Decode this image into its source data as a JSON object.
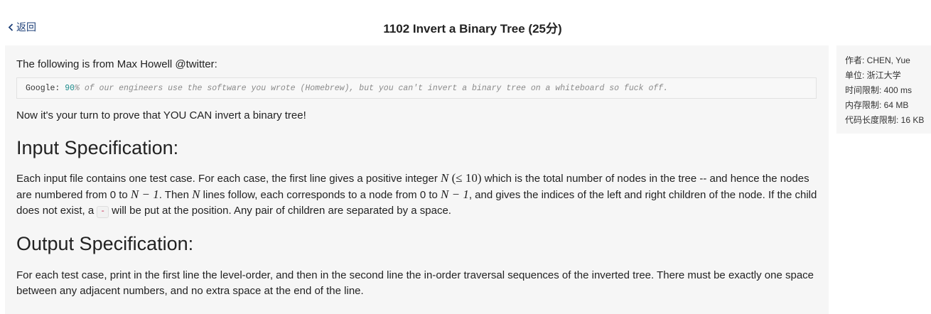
{
  "header": {
    "back_label": "返回",
    "title": "1102 Invert a Binary Tree (25分)"
  },
  "problem": {
    "intro": "The following is from Max Howell @twitter:",
    "quote": {
      "prefix": "Google: ",
      "number": "90",
      "rest": "% of our engineers use the software you wrote (Homebrew), but you can't invert a binary tree on a whiteboard so fuck off."
    },
    "challenge": "Now it's your turn to prove that YOU CAN invert a binary tree!",
    "input_heading": "Input Specification:",
    "input": {
      "t1": "Each input file contains one test case. For each case, the first line gives a positive integer ",
      "m1": "N",
      "m2": "(≤ 10)",
      "t2": " which is the total number of nodes in the tree -- and hence the nodes are numbered from 0 to ",
      "m3": "N − 1",
      "t3": ". Then ",
      "m4": "N",
      "t4": " lines follow, each corresponds to a node from 0 to ",
      "m5": "N − 1",
      "t5": ", and gives the indices of the left and right children of the node. If the child does not exist, a ",
      "code": "-",
      "t6": " will be put at the position. Any pair of children are separated by a space."
    },
    "output_heading": "Output Specification:",
    "output_text": "For each test case, print in the first line the level-order, and then in the second line the in-order traversal sequences of the inverted tree. There must be exactly one space between any adjacent numbers, and no extra space at the end of the line."
  },
  "sidebar": {
    "author": "作者: CHEN, Yue",
    "unit": "单位: 浙江大学",
    "time_limit": "时间限制: 400 ms",
    "memory_limit": "内存限制: 64 MB",
    "code_limit": "代码长度限制: 16 KB"
  },
  "colors": {
    "link": "#1d3f78",
    "panel_bg": "#f6f6f6",
    "code_number": "#1b8a8a"
  }
}
